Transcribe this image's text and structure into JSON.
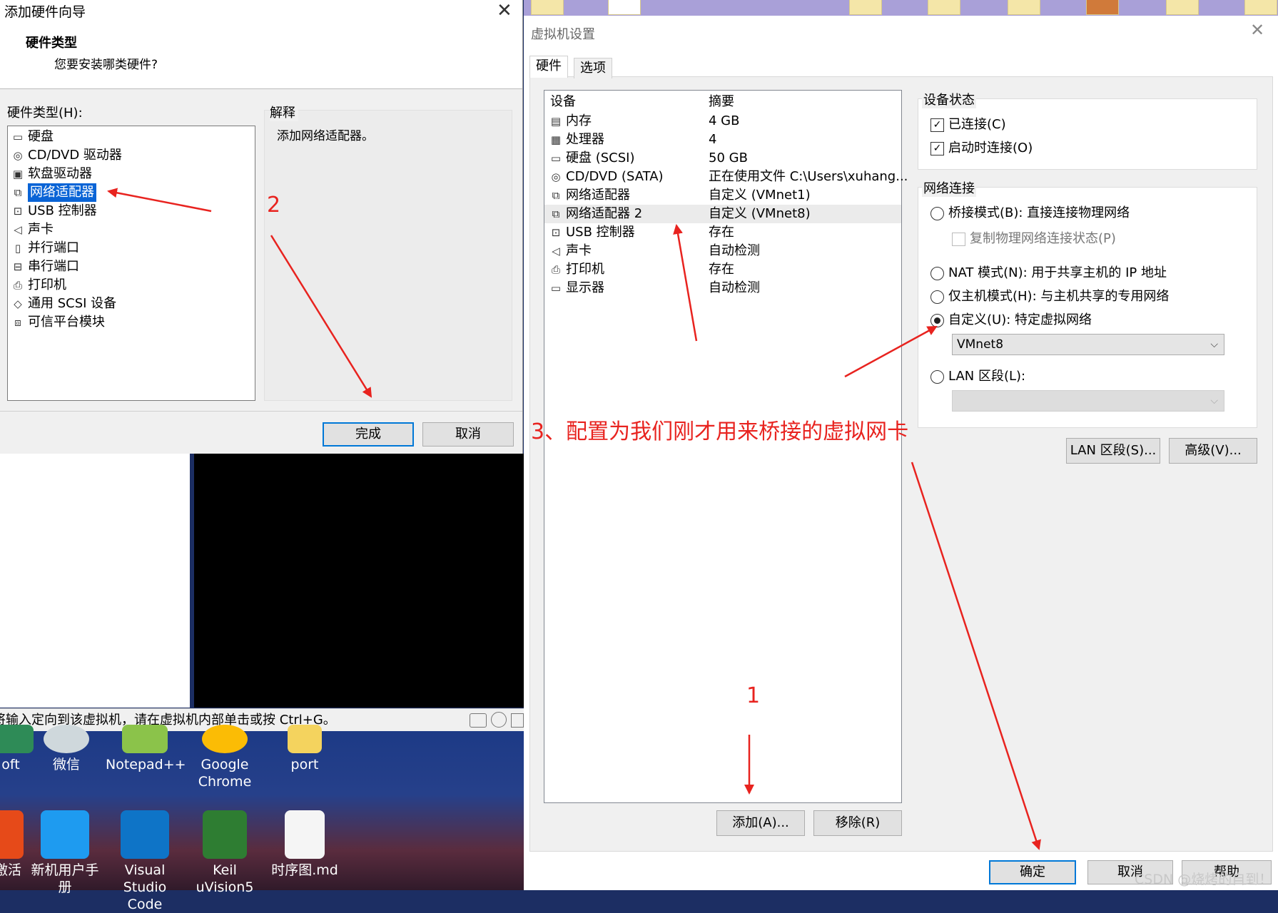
{
  "wizard": {
    "title": "添加硬件向导",
    "heading": "硬件类型",
    "subheading": "您要安装哪类硬件?",
    "hw_type_label": "硬件类型(H):",
    "explain_label": "解释",
    "explain_text": "添加网络适配器。",
    "items": [
      {
        "label": "硬盘",
        "icon": "hard-disk-icon"
      },
      {
        "label": "CD/DVD 驱动器",
        "icon": "cd-dvd-icon"
      },
      {
        "label": "软盘驱动器",
        "icon": "floppy-icon"
      },
      {
        "label": "网络适配器",
        "icon": "network-adapter-icon",
        "selected": true
      },
      {
        "label": "USB 控制器",
        "icon": "usb-icon"
      },
      {
        "label": "声卡",
        "icon": "sound-card-icon"
      },
      {
        "label": "并行端口",
        "icon": "parallel-port-icon"
      },
      {
        "label": "串行端口",
        "icon": "serial-port-icon"
      },
      {
        "label": "打印机",
        "icon": "printer-icon"
      },
      {
        "label": "通用 SCSI 设备",
        "icon": "scsi-icon"
      },
      {
        "label": "可信平台模块",
        "icon": "tpm-icon"
      }
    ],
    "finish_label": "完成",
    "cancel_label": "取消"
  },
  "vm_settings": {
    "title": "虚拟机设置",
    "tabs": [
      "硬件",
      "选项"
    ],
    "columns": {
      "device": "设备",
      "summary": "摘要"
    },
    "devices": [
      {
        "name": "内存",
        "summary": "4 GB",
        "icon": "memory-icon"
      },
      {
        "name": "处理器",
        "summary": "4",
        "icon": "cpu-icon"
      },
      {
        "name": "硬盘 (SCSI)",
        "summary": "50 GB",
        "icon": "hard-disk-icon"
      },
      {
        "name": "CD/DVD (SATA)",
        "summary": "正在使用文件 C:\\Users\\xuhang...",
        "icon": "cd-dvd-icon"
      },
      {
        "name": "网络适配器",
        "summary": "自定义 (VMnet1)",
        "icon": "network-adapter-icon"
      },
      {
        "name": "网络适配器 2",
        "summary": "自定义 (VMnet8)",
        "icon": "network-adapter-icon",
        "selected": true
      },
      {
        "name": "USB 控制器",
        "summary": "存在",
        "icon": "usb-icon"
      },
      {
        "name": "声卡",
        "summary": "自动检测",
        "icon": "sound-card-icon"
      },
      {
        "name": "打印机",
        "summary": "存在",
        "icon": "printer-icon"
      },
      {
        "name": "显示器",
        "summary": "自动检测",
        "icon": "monitor-icon"
      }
    ],
    "add_label": "添加(A)...",
    "remove_label": "移除(R)",
    "device_status": {
      "title": "设备状态",
      "connected": "已连接(C)",
      "connect_at_power_on": "启动时连接(O)"
    },
    "network": {
      "title": "网络连接",
      "bridged": "桥接模式(B): 直接连接物理网络",
      "replicate": "复制物理网络连接状态(P)",
      "nat": "NAT 模式(N): 用于共享主机的 IP 地址",
      "host_only": "仅主机模式(H): 与主机共享的专用网络",
      "custom": "自定义(U): 特定虚拟网络",
      "custom_value": "VMnet8",
      "lan_segment": "LAN 区段(L):"
    },
    "lan_segments_label": "LAN 区段(S)...",
    "advanced_label": "高级(V)...",
    "ok_label": "确定",
    "cancel_label": "取消",
    "help_label": "帮助"
  },
  "vm_status_text": "将输入定向到该虚拟机，请在虚拟机内部单击或按 Ctrl+G。",
  "desktop_icons_row1": [
    "oft",
    "微信",
    "Notepad++",
    "Google\nChrome",
    "port"
  ],
  "desktop_icons_row2": [
    "激活",
    "新机用户手册",
    "Visual\nStudio Code",
    "Keil\nuVision5",
    "时序图.md"
  ],
  "annotations": {
    "step1": "1",
    "step2": "2",
    "step3": "3、配置为我们刚才用来桥接的虚拟网卡"
  },
  "watermark": "CSDN @烧烤的自到！",
  "colors": {
    "annotation": "#e8231f",
    "selection": "#0a64d6",
    "default_border": "#0078d7"
  }
}
